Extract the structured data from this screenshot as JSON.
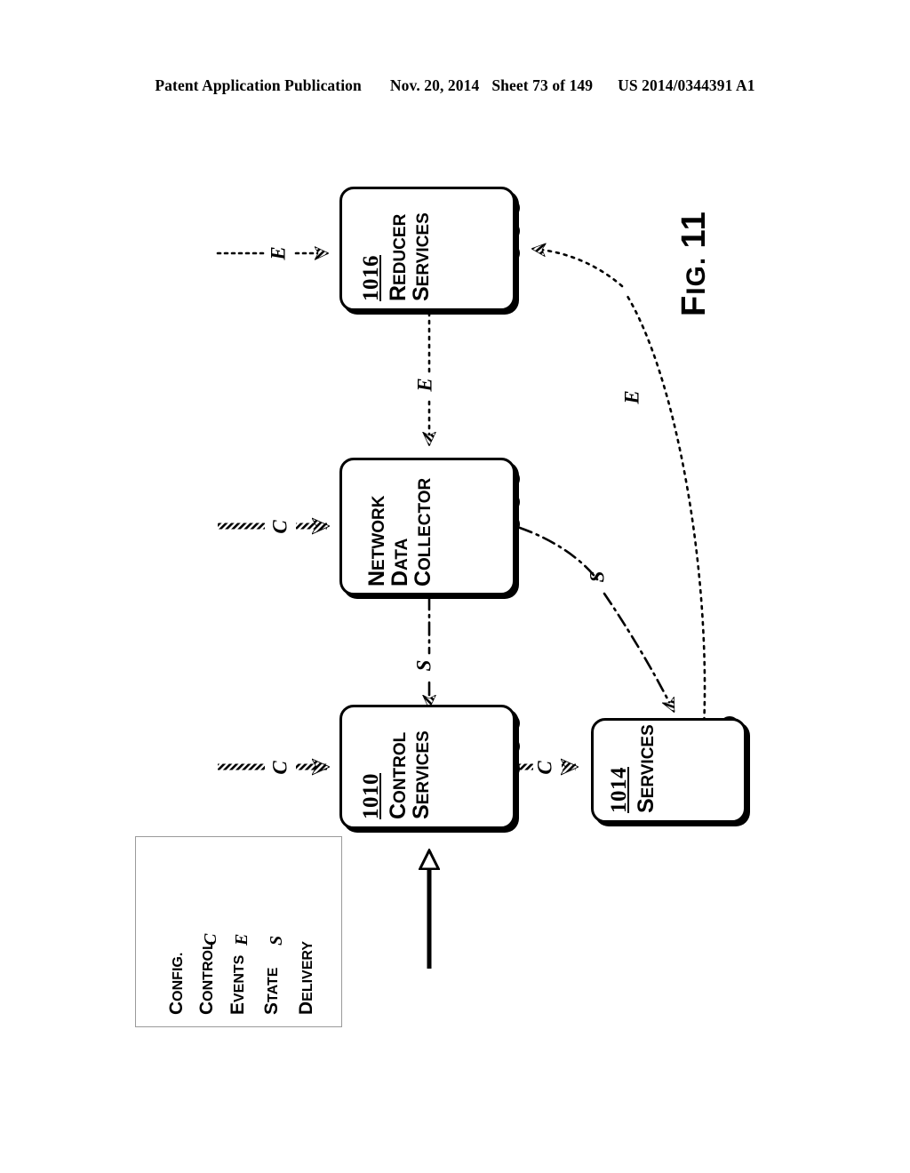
{
  "header": {
    "publication": "Patent Application Publication",
    "date": "Nov. 20, 2014",
    "sheet": "Sheet 73 of 149",
    "docnum": "US 2014/0344391 A1"
  },
  "figure": {
    "label_big": "F",
    "label_rest": "IG. ",
    "label_num": "11",
    "label_full": "FIG. 11"
  },
  "boxes": [
    {
      "id": "reducer-services",
      "ref": "1016",
      "lines": [
        {
          "first": "R",
          "rest": "EDUCER"
        },
        {
          "first": "S",
          "rest": "ERVICES"
        }
      ],
      "name_full": "REDUCER SERVICES"
    },
    {
      "id": "network-data-collector",
      "ref": "",
      "lines": [
        {
          "first": "N",
          "rest": "ETWORK"
        },
        {
          "first": "D",
          "rest": "ATA"
        },
        {
          "first": "C",
          "rest": "OLLECTOR"
        }
      ],
      "name_full": "NETWORK DATA COLLECTOR"
    },
    {
      "id": "control-services",
      "ref": "1010",
      "lines": [
        {
          "first": "C",
          "rest": "ONTROL"
        },
        {
          "first": "S",
          "rest": "ERVICES"
        }
      ],
      "name_full": "CONTROL SERVICES"
    },
    {
      "id": "services",
      "ref": "1014",
      "lines": [
        {
          "first": "S",
          "rest": "ERVICES"
        }
      ],
      "name_full": "SERVICES"
    }
  ],
  "legend": {
    "title": "",
    "entries": [
      {
        "label_first": "C",
        "label_rest": "ONFIG.",
        "label_full": "CONFIG.",
        "glyph": "",
        "style": "config"
      },
      {
        "label_first": "C",
        "label_rest": "ONTROL",
        "label_full": "CONTROL",
        "glyph": "C",
        "style": "control"
      },
      {
        "label_first": "E",
        "label_rest": "VENTS",
        "label_full": "EVENTS",
        "glyph": "E",
        "style": "events"
      },
      {
        "label_first": "S",
        "label_rest": "TATE",
        "label_full": "STATE",
        "glyph": "S",
        "style": "state"
      },
      {
        "label_first": "D",
        "label_rest": "ELIVERY",
        "label_full": "DELIVERY",
        "glyph": "",
        "style": "delivery"
      }
    ]
  },
  "connectors": [
    {
      "id": "control-in-control-services",
      "glyph": "C",
      "kind": "control"
    },
    {
      "id": "control-in-network-data-collector",
      "glyph": "C",
      "kind": "control"
    },
    {
      "id": "events-in-reducer-services",
      "glyph": "E",
      "kind": "events"
    },
    {
      "id": "control-control-services-to-services",
      "glyph": "C",
      "kind": "control"
    },
    {
      "id": "events-reducer-to-collector",
      "glyph": "E",
      "kind": "events"
    },
    {
      "id": "state-collector-to-control-services",
      "glyph": "S",
      "kind": "state"
    },
    {
      "id": "events-services-to-reducer",
      "glyph": "E",
      "kind": "events"
    },
    {
      "id": "state-collector-to-services",
      "glyph": "S",
      "kind": "state"
    },
    {
      "id": "config-into-control-services",
      "glyph": "",
      "kind": "config"
    }
  ],
  "colors": {
    "ink": "#000000",
    "paper": "#ffffff",
    "legend_border": "#9a9a9a"
  }
}
